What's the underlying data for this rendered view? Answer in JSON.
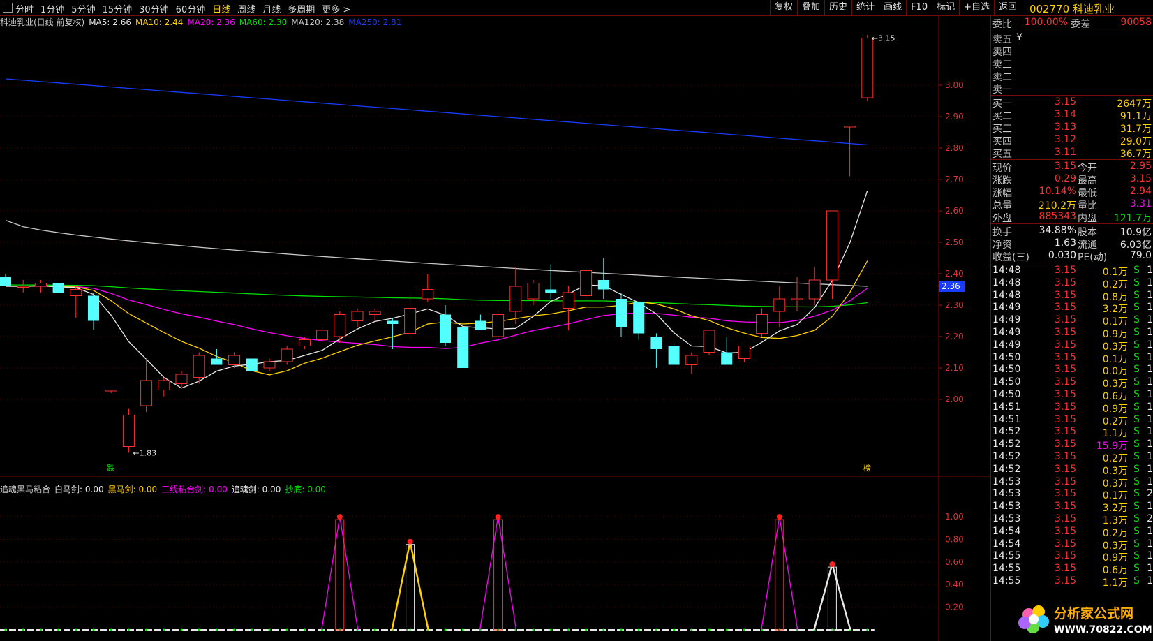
{
  "toolbar": {
    "periods": [
      "分时",
      "1分钟",
      "5分钟",
      "15分钟",
      "30分钟",
      "60分钟",
      "日线",
      "周线",
      "月线",
      "多周期",
      "更多 >"
    ],
    "active_period": "日线",
    "right_buttons": [
      "复权",
      "叠加",
      "历史",
      "统计",
      "画线",
      "F10",
      "标记",
      "+自选",
      "返回"
    ]
  },
  "stock": {
    "code": "002770",
    "name": "科迪乳业"
  },
  "ma_bar": {
    "title": "科迪乳业(日线 前复权)",
    "items": [
      {
        "label": "MA5: 2.66",
        "color": "#e8e8e8"
      },
      {
        "label": "MA10: 2.44",
        "color": "#ffd000"
      },
      {
        "label": "MA20: 2.36",
        "color": "#ff00ff"
      },
      {
        "label": "MA60: 2.30",
        "color": "#00e000"
      },
      {
        "label": "MA120: 2.38",
        "color": "#c8c8c8"
      },
      {
        "label": "MA250: 2.81",
        "color": "#1a3cff"
      }
    ]
  },
  "indicator_bar": {
    "title": "追魂黑马粘合",
    "items": [
      {
        "label": "白马剑: 0.00",
        "color": "#e8e8e8"
      },
      {
        "label": "黑马剑: 0.00",
        "color": "#ffd000"
      },
      {
        "label": "三线粘合剑: 0.00",
        "color": "#ff00ff"
      },
      {
        "label": "追魂剑: 0.00",
        "color": "#e8e8e8"
      },
      {
        "label": "抄底: 0.00",
        "color": "#00e000"
      }
    ]
  },
  "chart_data": {
    "type": "candlestick",
    "price_axis": {
      "ticks": [
        "3.00",
        "2.90",
        "2.80",
        "2.70",
        "2.60",
        "2.50",
        "2.40",
        "2.30",
        "2.20",
        "2.10",
        "2.00"
      ],
      "ylim": [
        1.8,
        3.2
      ],
      "current_label": "2.36"
    },
    "annotations": {
      "low": "1.83",
      "high": "3.15",
      "low_marker": "跌",
      "high_marker": "榜"
    },
    "candles": [
      {
        "o": 2.39,
        "h": 2.4,
        "l": 2.36,
        "c": 2.36
      },
      {
        "o": 2.36,
        "h": 2.38,
        "l": 2.34,
        "c": 2.36
      },
      {
        "o": 2.36,
        "h": 2.38,
        "l": 2.34,
        "c": 2.37
      },
      {
        "o": 2.37,
        "h": 2.37,
        "l": 2.34,
        "c": 2.34
      },
      {
        "o": 2.33,
        "h": 2.36,
        "l": 2.26,
        "c": 2.35
      },
      {
        "o": 2.33,
        "h": 2.34,
        "l": 2.22,
        "c": 2.25
      },
      {
        "o": 2.03,
        "h": 2.03,
        "l": 2.02,
        "c": 2.03
      },
      {
        "o": 1.85,
        "h": 1.97,
        "l": 1.83,
        "c": 1.95
      },
      {
        "o": 1.98,
        "h": 2.13,
        "l": 1.96,
        "c": 2.06
      },
      {
        "o": 2.03,
        "h": 2.07,
        "l": 2.01,
        "c": 2.06
      },
      {
        "o": 2.05,
        "h": 2.09,
        "l": 2.04,
        "c": 2.08
      },
      {
        "o": 2.07,
        "h": 2.15,
        "l": 2.05,
        "c": 2.14
      },
      {
        "o": 2.13,
        "h": 2.16,
        "l": 2.11,
        "c": 2.11
      },
      {
        "o": 2.11,
        "h": 2.15,
        "l": 2.1,
        "c": 2.14
      },
      {
        "o": 2.13,
        "h": 2.13,
        "l": 2.09,
        "c": 2.09
      },
      {
        "o": 2.1,
        "h": 2.13,
        "l": 2.09,
        "c": 2.12
      },
      {
        "o": 2.12,
        "h": 2.17,
        "l": 2.11,
        "c": 2.16
      },
      {
        "o": 2.17,
        "h": 2.2,
        "l": 2.16,
        "c": 2.19
      },
      {
        "o": 2.19,
        "h": 2.23,
        "l": 2.18,
        "c": 2.22
      },
      {
        "o": 2.2,
        "h": 2.28,
        "l": 2.18,
        "c": 2.27
      },
      {
        "o": 2.25,
        "h": 2.29,
        "l": 2.23,
        "c": 2.28
      },
      {
        "o": 2.27,
        "h": 2.29,
        "l": 2.25,
        "c": 2.28
      },
      {
        "o": 2.25,
        "h": 2.26,
        "l": 2.16,
        "c": 2.24
      },
      {
        "o": 2.21,
        "h": 2.33,
        "l": 2.19,
        "c": 2.29
      },
      {
        "o": 2.32,
        "h": 2.4,
        "l": 2.31,
        "c": 2.35
      },
      {
        "o": 2.27,
        "h": 2.3,
        "l": 2.17,
        "c": 2.18
      },
      {
        "o": 2.23,
        "h": 2.23,
        "l": 2.1,
        "c": 2.1
      },
      {
        "o": 2.25,
        "h": 2.27,
        "l": 2.22,
        "c": 2.22
      },
      {
        "o": 2.2,
        "h": 2.28,
        "l": 2.19,
        "c": 2.27
      },
      {
        "o": 2.28,
        "h": 2.42,
        "l": 2.24,
        "c": 2.36
      },
      {
        "o": 2.32,
        "h": 2.38,
        "l": 2.3,
        "c": 2.37
      },
      {
        "o": 2.35,
        "h": 2.43,
        "l": 2.32,
        "c": 2.34
      },
      {
        "o": 2.29,
        "h": 2.36,
        "l": 2.22,
        "c": 2.34
      },
      {
        "o": 2.33,
        "h": 2.42,
        "l": 2.32,
        "c": 2.41
      },
      {
        "o": 2.38,
        "h": 2.45,
        "l": 2.32,
        "c": 2.35
      },
      {
        "o": 2.32,
        "h": 2.34,
        "l": 2.2,
        "c": 2.23
      },
      {
        "o": 2.31,
        "h": 2.3,
        "l": 2.19,
        "c": 2.21
      },
      {
        "o": 2.2,
        "h": 2.21,
        "l": 2.1,
        "c": 2.16
      },
      {
        "o": 2.17,
        "h": 2.18,
        "l": 2.11,
        "c": 2.11
      },
      {
        "o": 2.11,
        "h": 2.15,
        "l": 2.08,
        "c": 2.14
      },
      {
        "o": 2.15,
        "h": 2.22,
        "l": 2.14,
        "c": 2.22
      },
      {
        "o": 2.15,
        "h": 2.2,
        "l": 2.11,
        "c": 2.11
      },
      {
        "o": 2.13,
        "h": 2.17,
        "l": 2.12,
        "c": 2.17
      },
      {
        "o": 2.21,
        "h": 2.29,
        "l": 2.2,
        "c": 2.27
      },
      {
        "o": 2.28,
        "h": 2.36,
        "l": 2.23,
        "c": 2.32
      },
      {
        "o": 2.32,
        "h": 2.39,
        "l": 2.28,
        "c": 2.32
      },
      {
        "o": 2.32,
        "h": 2.42,
        "l": 2.3,
        "c": 2.38
      },
      {
        "o": 2.38,
        "h": 2.59,
        "l": 2.32,
        "c": 2.6
      },
      {
        "o": 2.87,
        "h": 2.87,
        "l": 2.71,
        "c": 2.87
      },
      {
        "o": 2.96,
        "h": 3.16,
        "l": 2.95,
        "c": 3.15
      }
    ],
    "sub_axis": {
      "ticks": [
        "1.00",
        "0.80",
        "0.60",
        "0.40",
        "0.20"
      ],
      "ylim": [
        0,
        1.05
      ]
    },
    "signals": [
      {
        "bar": 19,
        "value": 1.0,
        "series": "三线粘合剑"
      },
      {
        "bar": 23,
        "value": 0.78,
        "series": "黑马剑"
      },
      {
        "bar": 28,
        "value": 1.0,
        "series": "三线粘合剑"
      },
      {
        "bar": 44,
        "value": 1.0,
        "series": "三线粘合剑"
      },
      {
        "bar": 47,
        "value": 0.58,
        "series": "白马剑"
      }
    ]
  },
  "quote": {
    "weibi": {
      "label": "委比",
      "value": "100.00%",
      "label2": "委差",
      "value2": "90058"
    },
    "sell": [
      {
        "label": "卖五",
        "price": "",
        "vol": "¥"
      },
      {
        "label": "卖四",
        "price": "",
        "vol": ""
      },
      {
        "label": "卖三",
        "price": "",
        "vol": ""
      },
      {
        "label": "卖二",
        "price": "",
        "vol": ""
      },
      {
        "label": "卖一",
        "price": "",
        "vol": ""
      }
    ],
    "buy": [
      {
        "label": "买一",
        "price": "3.15",
        "vol": "2647万"
      },
      {
        "label": "买二",
        "price": "3.14",
        "vol": "91.1万"
      },
      {
        "label": "买三",
        "price": "3.13",
        "vol": "31.7万"
      },
      {
        "label": "买四",
        "price": "3.12",
        "vol": "29.0万"
      },
      {
        "label": "买五",
        "price": "3.11",
        "vol": "36.7万"
      }
    ],
    "stats": [
      {
        "l1": "现价",
        "v1": "3.15",
        "l2": "今开",
        "v2": "2.95",
        "c1": "red",
        "c2": "red"
      },
      {
        "l1": "涨跌",
        "v1": "0.29",
        "l2": "最高",
        "v2": "3.15",
        "c1": "red",
        "c2": "red"
      },
      {
        "l1": "涨幅",
        "v1": "10.14%",
        "l2": "最低",
        "v2": "2.94",
        "c1": "red",
        "c2": "red"
      },
      {
        "l1": "总量",
        "v1": "210.2万",
        "l2": "量比",
        "v2": "3.31",
        "c1": "yel",
        "c2": "mag"
      },
      {
        "l1": "外盘",
        "v1": "885343",
        "l2": "内盘",
        "v2": "121.7万",
        "c1": "red",
        "c2": "green"
      }
    ],
    "stats2": [
      {
        "l1": "换手",
        "v1": "34.88%",
        "l2": "股本",
        "v2": "10.9亿"
      },
      {
        "l1": "净资",
        "v1": "1.63",
        "l2": "流通",
        "v2": "6.03亿"
      },
      {
        "l1": "收益(三)",
        "v1": "0.030",
        "l2": "PE(动)",
        "v2": "79.0"
      }
    ],
    "ticks": [
      {
        "t": "14:48",
        "p": "3.15",
        "v": "0.1万",
        "s": "S",
        "n": "1"
      },
      {
        "t": "14:48",
        "p": "3.15",
        "v": "0.2万",
        "s": "S",
        "n": "1"
      },
      {
        "t": "14:48",
        "p": "3.15",
        "v": "0.8万",
        "s": "S",
        "n": "1"
      },
      {
        "t": "14:49",
        "p": "3.15",
        "v": "3.2万",
        "s": "S",
        "n": "1"
      },
      {
        "t": "14:49",
        "p": "3.15",
        "v": "0.1万",
        "s": "S",
        "n": "1"
      },
      {
        "t": "14:49",
        "p": "3.15",
        "v": "0.9万",
        "s": "S",
        "n": "1"
      },
      {
        "t": "14:49",
        "p": "3.15",
        "v": "0.3万",
        "s": "S",
        "n": "1"
      },
      {
        "t": "14:50",
        "p": "3.15",
        "v": "0.1万",
        "s": "S",
        "n": "1"
      },
      {
        "t": "14:50",
        "p": "3.15",
        "v": "0.0万",
        "s": "S",
        "n": "1"
      },
      {
        "t": "14:50",
        "p": "3.15",
        "v": "0.3万",
        "s": "S",
        "n": "1"
      },
      {
        "t": "14:50",
        "p": "3.15",
        "v": "0.6万",
        "s": "S",
        "n": "1"
      },
      {
        "t": "14:51",
        "p": "3.15",
        "v": "0.9万",
        "s": "S",
        "n": "1"
      },
      {
        "t": "14:51",
        "p": "3.15",
        "v": "0.2万",
        "s": "S",
        "n": "1"
      },
      {
        "t": "14:52",
        "p": "3.15",
        "v": "1.1万",
        "s": "S",
        "n": "1"
      },
      {
        "t": "14:52",
        "p": "3.15",
        "v": "15.9万",
        "s": "S",
        "n": "1",
        "hl": true
      },
      {
        "t": "14:52",
        "p": "3.15",
        "v": "0.2万",
        "s": "S",
        "n": "1"
      },
      {
        "t": "14:52",
        "p": "3.15",
        "v": "0.3万",
        "s": "S",
        "n": "1"
      },
      {
        "t": "14:53",
        "p": "3.15",
        "v": "0.3万",
        "s": "S",
        "n": "1"
      },
      {
        "t": "14:53",
        "p": "3.15",
        "v": "0.1万",
        "s": "S",
        "n": "2"
      },
      {
        "t": "14:53",
        "p": "3.15",
        "v": "3.2万",
        "s": "S",
        "n": "1"
      },
      {
        "t": "14:53",
        "p": "3.15",
        "v": "1.3万",
        "s": "S",
        "n": "2"
      },
      {
        "t": "14:54",
        "p": "3.15",
        "v": "0.2万",
        "s": "S",
        "n": "1"
      },
      {
        "t": "14:54",
        "p": "3.15",
        "v": "0.3万",
        "s": "S",
        "n": "1"
      },
      {
        "t": "14:55",
        "p": "3.15",
        "v": "0.9万",
        "s": "S",
        "n": "1"
      },
      {
        "t": "14:55",
        "p": "3.15",
        "v": "0.6万",
        "s": "S",
        "n": "1"
      },
      {
        "t": "14:55",
        "p": "3.15",
        "v": "1.1万",
        "s": "S",
        "n": "1"
      }
    ]
  },
  "watermark": {
    "brand": "分析家公式网",
    "url": "WWW.70822.COM"
  }
}
